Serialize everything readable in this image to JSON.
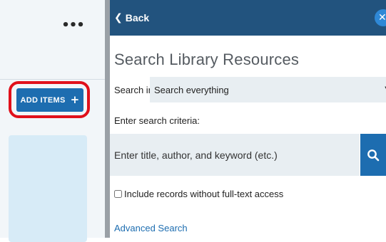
{
  "left_panel": {
    "more_label": "•••",
    "add_items": {
      "label": "ADD ITEMS",
      "icon": "plus-icon",
      "plus_glyph": "+"
    }
  },
  "search_panel": {
    "back_label": "Back",
    "close_glyph": "✕",
    "title": "Search Library Resources",
    "search_in_label": "Search in:",
    "scope_value": "Search everything",
    "criteria_label": "Enter search criteria:",
    "search_placeholder": "Enter title, author, and keyword (etc.)",
    "fulltext_label": "Include records without full-text access",
    "advanced_search_label": "Advanced Search"
  },
  "colors": {
    "header_bg": "#22537e",
    "primary_button": "#1d6db0",
    "highlight_ring": "#e0101b",
    "input_bg": "#e8eef2"
  }
}
